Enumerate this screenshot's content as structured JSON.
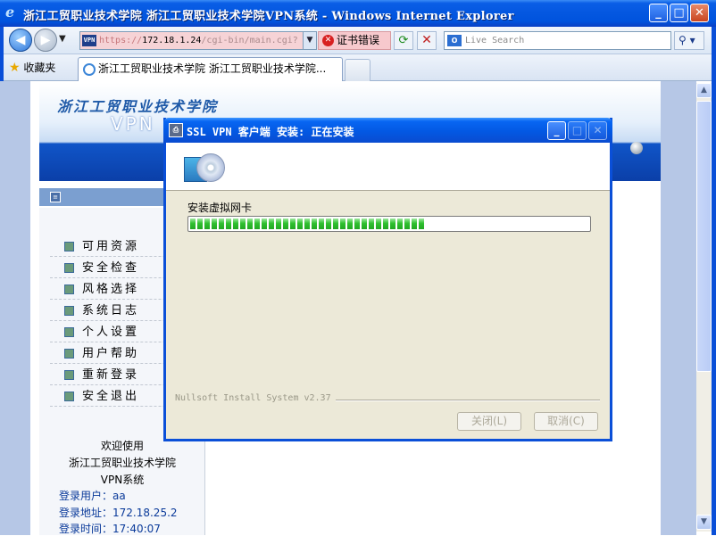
{
  "window": {
    "title": "浙江工贸职业技术学院 浙江工贸职业技术学院VPN系统 - Windows Internet Explorer",
    "minimize_glyph": "_",
    "maximize_glyph": "□",
    "close_glyph": "✕"
  },
  "navbar": {
    "back_glyph": "◀",
    "forward_glyph": "▶",
    "address_protocol": "https://",
    "address_host": "172.18.1.24",
    "address_path": "/cgi-bin/main.cgi?",
    "site_badge": "VPN",
    "cert_error": "证书错误",
    "search_placeholder": "Live Search"
  },
  "favorites": {
    "label": "收藏夹",
    "tab_title": "浙江工贸职业技术学院 浙江工贸职业技术学院..."
  },
  "page": {
    "school_name": "浙江工贸职业技术学院",
    "vpn_label": "VPN",
    "menu": [
      {
        "label": "可用资源"
      },
      {
        "label": "安全检查"
      },
      {
        "label": "风格选择"
      },
      {
        "label": "系统日志"
      },
      {
        "label": "个人设置"
      },
      {
        "label": "用户帮助"
      },
      {
        "label": "重新登录"
      },
      {
        "label": "安全退出"
      }
    ],
    "welcome": {
      "line1": "欢迎使用",
      "line2": "浙江工贸职业技术学院",
      "line3": "VPN系统"
    },
    "login_user": "登录用户：aa",
    "login_address": "登录地址：172.18.25.2",
    "login_time": "登录时间：17:40:07"
  },
  "installer": {
    "title": "SSL VPN 客户端 安装: 正在安装",
    "task": "安装虚拟网卡",
    "progress": 0.59,
    "brand": "Nullsoft Install System v2.37",
    "close_button": "关闭(L)",
    "cancel_button": "取消(C)",
    "enabled_buttons": false
  }
}
